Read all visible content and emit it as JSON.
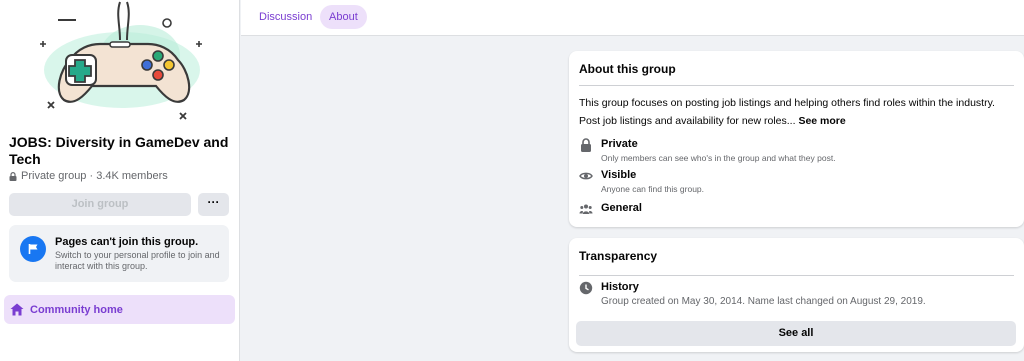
{
  "group": {
    "name": "JOBS: Diversity in GameDev and Tech",
    "meta": "Private group · 3.4K members",
    "join_label": "Join group",
    "more_label": "···"
  },
  "pages_notice": {
    "title": "Pages can't join this group.",
    "description": "Switch to your personal profile to join and interact with this group."
  },
  "sidebar": {
    "community_home": "Community home"
  },
  "tabs": [
    {
      "label": "Discussion",
      "active": false
    },
    {
      "label": "About",
      "active": true
    }
  ],
  "about": {
    "title": "About this group",
    "description": "This group focuses on posting job listings and helping others find roles within the industry.",
    "description2": "Post job listings and availability for new roles...",
    "see_more": "See more",
    "items": [
      {
        "icon": "lock-icon",
        "title": "Private",
        "subtitle": "Only members can see who's in the group and what they post."
      },
      {
        "icon": "eye-icon",
        "title": "Visible",
        "subtitle": "Anyone can find this group."
      },
      {
        "icon": "people-icon",
        "title": "General",
        "subtitle": ""
      }
    ]
  },
  "transparency": {
    "title": "Transparency",
    "history_title": "History",
    "history_text": "Group created on May 30, 2014. Name last changed on August 29, 2019.",
    "see_all": "See all"
  },
  "colors": {
    "accent": "#7a3dd1",
    "accent_bg": "#ede0fa",
    "brand_blue": "#1877f2",
    "page_bg": "#f0f2f5"
  }
}
